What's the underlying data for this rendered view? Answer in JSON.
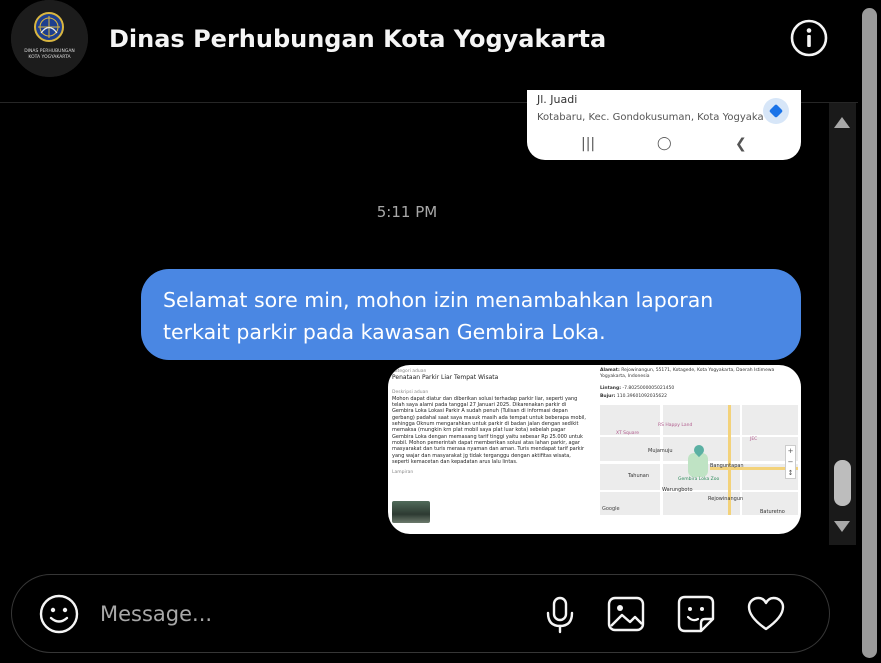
{
  "header": {
    "title": "Dinas Perhubungan Kota Yogyakarta",
    "avatar_line1": "DINAS PERHUBUNGAN",
    "avatar_line2": "KOTA YOGYAKARTA"
  },
  "thread": {
    "maps_card": {
      "place_name": "Jl. Juadi",
      "address": "Kotabaru, Kec. Gondokusuman, Kota Yogyakarta, ..."
    },
    "timestamp": "5:11 PM",
    "message": "Selamat sore min, mohon izin menambahkan laporan terkait parkir pada kawasan Gembira Loka.",
    "attachment": {
      "label_top": "Kategori aduan",
      "category": "Penataan Parkir Liar Tempat Wisata",
      "desc_label": "Deskripsi aduan",
      "description": "Mohon dapat diatur dan diberikan solusi terhadap parkir liar, seperti yang telah saya alami pada tanggal 27 Januari 2025. Dikarenakan parkir di Gembira Loka Lokasi Parkir A sudah penuh (Tulisan di informasi depan gerbang) padahal saat saya masuk masih ada tempat untuk beberapa mobil, sehingga Oknum mengarahkan untuk parkir di badan jalan dengan sedikit memaksa (mungkin krn plat mobil saya plat luar kota) sebelah pagar Gembira Loka dengan memasang tarif tinggi yaitu sebesar Rp 25.000 untuk mobil. Mohon pemerintah dapat memberikan solusi atas lahan parkir, agar masyarakat dan turis merasa nyaman dan aman. Turis mendapat tarif parkir yang wajar dan masyarakat jg tidak terganggu dengan aktifitas wisata, seperti kemacetan dan kepadatan arus lalu lintas.",
      "attach_label": "Lampiran",
      "address_label": "Alamat:",
      "address": "Rejowinangun, 55171, Kotagede, Kota Yogyakarta, Daerah Istimewa Yogyakarta, Indonesia",
      "lat_label": "Lintang:",
      "lat": "-7.8025000005021450",
      "lng_label": "Bujur:",
      "lng": "110.39601092035622",
      "map_labels": {
        "area1": "Mujamuju",
        "area2": "Tahunan",
        "area3": "Warungboto",
        "area4": "Banguntapan",
        "area5": "Rejowinangun",
        "area6": "Baturetno",
        "poi1": "XT Square",
        "poi2": "Gembira Loka Zoo",
        "poi3": "RS Happy Land",
        "poi4": "JEC",
        "attribution": "Google"
      }
    }
  },
  "composer": {
    "placeholder": "Message..."
  },
  "icons": {
    "info": "info-icon",
    "emoji": "emoji-icon",
    "mic": "microphone-icon",
    "image": "image-icon",
    "sticker": "sticker-icon",
    "like": "heart-icon"
  },
  "colors": {
    "bubble": "#4a87e3",
    "background": "#000000"
  }
}
